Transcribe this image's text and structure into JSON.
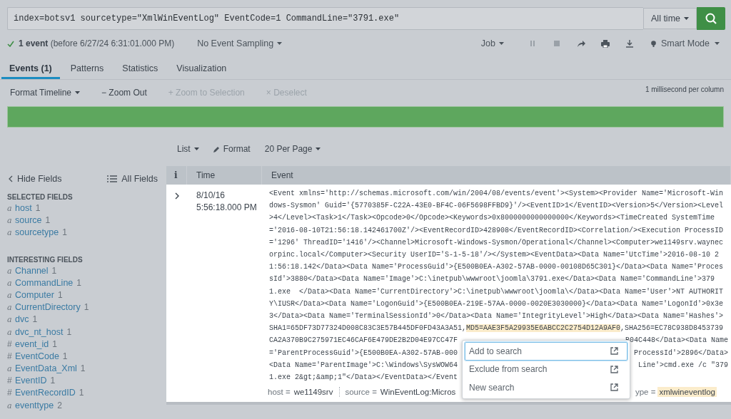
{
  "search": {
    "query": "index=botsv1 sourcetype=\"XmlWinEventLog\" EventCode=1 CommandLine=\"3791.exe\"",
    "time_range": "All time"
  },
  "status": {
    "summary": "**1 event** (before 6/27/24 6:31:01.000 PM)",
    "sampling": "No Event Sampling",
    "job": "Job",
    "mode": "Smart Mode"
  },
  "tabs": [
    {
      "label": "Events (1)",
      "selected": true
    },
    {
      "label": "Patterns",
      "selected": false
    },
    {
      "label": "Statistics",
      "selected": false
    },
    {
      "label": "Visualization",
      "selected": false
    }
  ],
  "timeline": {
    "controls": [
      {
        "label": "Format Timeline",
        "kind": "dropdown",
        "disabled": false
      },
      {
        "label": "− Zoom Out",
        "kind": "action",
        "disabled": false
      },
      {
        "label": "+ Zoom to Selection",
        "kind": "action",
        "disabled": true
      },
      {
        "label": "× Deselect",
        "kind": "action",
        "disabled": true
      }
    ],
    "resolution": "1 millisecond per column"
  },
  "results_controls": [
    {
      "label": "List",
      "kind": "dropdown"
    },
    {
      "label": "Format",
      "kind": "edit"
    },
    {
      "label": "20 Per Page",
      "kind": "dropdown"
    }
  ],
  "sidebar": {
    "hide_fields": "Hide Fields",
    "all_fields": "All Fields",
    "sections": [
      {
        "title": "SELECTED FIELDS",
        "fields": [
          {
            "type": "a",
            "name": "host",
            "count": "1"
          },
          {
            "type": "a",
            "name": "source",
            "count": "1"
          },
          {
            "type": "a",
            "name": "sourcetype",
            "count": "1"
          }
        ]
      },
      {
        "title": "INTERESTING FIELDS",
        "fields": [
          {
            "type": "a",
            "name": "Channel",
            "count": "1"
          },
          {
            "type": "a",
            "name": "CommandLine",
            "count": "1"
          },
          {
            "type": "a",
            "name": "Computer",
            "count": "1"
          },
          {
            "type": "a",
            "name": "CurrentDirectory",
            "count": "1"
          },
          {
            "type": "a",
            "name": "dvc",
            "count": "1"
          },
          {
            "type": "a",
            "name": "dvc_nt_host",
            "count": "1"
          },
          {
            "type": "#",
            "name": "event_id",
            "count": "1"
          },
          {
            "type": "#",
            "name": "EventCode",
            "count": "1"
          },
          {
            "type": "a",
            "name": "EventData_Xml",
            "count": "1"
          },
          {
            "type": "#",
            "name": "EventID",
            "count": "1"
          },
          {
            "type": "#",
            "name": "EventRecordID",
            "count": "1"
          },
          {
            "type": "a",
            "name": "eventtype",
            "count": "2"
          }
        ]
      }
    ]
  },
  "table": {
    "columns": [
      "i",
      "Time",
      "Event"
    ],
    "event": {
      "time": [
        "8/10/16",
        "5:56:18.000 PM"
      ],
      "lines": [
        {
          "left": "<Event xmlns='http://schemas.microsoft.com/win/2004/08/events/event'><System><Provider Name='Microsoft-Win"
        },
        {
          "left": "dows-Sysmon' Guid='{5770385F-C22A-43E0-BF4C-06F5698FFBD9}'/><EventID>1</EventID><Version>5</Version><Level"
        },
        {
          "left": ">4</Level><Task>1</Task><Opcode>0</Opcode><Keywords>0x8000000000000000</Keywords><TimeCreated SystemTime"
        },
        {
          "left": "='2016-08-10T21:56:18.142461700Z'/><EventRecordID>428908</EventRecordID><Correlation/><Execution ProcessID"
        },
        {
          "left": "='1296' ThreadID='1416'/><Channel>Microsoft-Windows-Sysmon/Operational</Channel><Computer>we1149srv.waynec"
        },
        {
          "left": "orpinc.local</Computer><Security UserID='S-1-5-18'/></System><EventData><Data Name='UtcTime'>2016-08-10 2"
        },
        {
          "left": "1:56:18.142</Data><Data Name='ProcessGuid'>{E500B0EA-A302-57AB-0000-00108D65C301}</Data><Data Name='Proces"
        },
        {
          "left": "sId'>3880</Data><Data Name='Image'>C:\\inetpub\\wwwroot\\joomla\\3791.exe</Data><Data Name='CommandLine'>379"
        },
        {
          "left": "1.exe  </Data><Data Name='CurrentDirectory'>C:\\inetpub\\wwwroot\\joomla\\</Data><Data Name='User'>NT AUTHORIT"
        },
        {
          "left": "Y\\IUSR</Data><Data Name='LogonGuid'>{E500B0EA-219E-57AA-0000-0020E3030000}</Data><Data Name='LogonId'>0x3e"
        },
        {
          "left": "3</Data><Data Name='TerminalSessionId'>0</Data><Data Name='IntegrityLevel'>High</Data><Data Name='Hashes'>"
        },
        {
          "left": "SHA1=65DF73D77324D008C83C3E57B445DF0FD43A3A51,",
          "highlight": "MD5=AAE3F5A29935E6ABCC2C2754D12A9AF0",
          "after": ",SHA256=EC78C938D8453739"
        },
        {
          "left": "CA2A370B9C275971EC46CAF6E479DE2B2D04E97CC47F",
          "right": "B04C448</Data><Data Name"
        },
        {
          "left": "='ParentProcessGuid'>{E500B0EA-A302-57AB-000",
          "right": "ProcessId'>2896</Data>"
        },
        {
          "left": "<Data Name='ParentImage'>C:\\Windows\\SysWOW64",
          "right": "Line'>cmd.exe /c \"379"
        },
        {
          "left": "1.exe 2&gt;&amp;1\"</Data></EventData></Event"
        }
      ],
      "fields": [
        {
          "key": "host =",
          "value": "we1149srv",
          "highlighted": false
        },
        {
          "key": "source =",
          "value": "WinEventLog:Micros",
          "highlighted": false
        },
        {
          "key": "ype =",
          "value": "xmlwineventlog",
          "highlighted": true
        }
      ]
    }
  },
  "context_menu": [
    {
      "label": "Add to search",
      "selected": true
    },
    {
      "label": "Exclude from search",
      "selected": false
    },
    {
      "label": "New search",
      "selected": false
    }
  ]
}
